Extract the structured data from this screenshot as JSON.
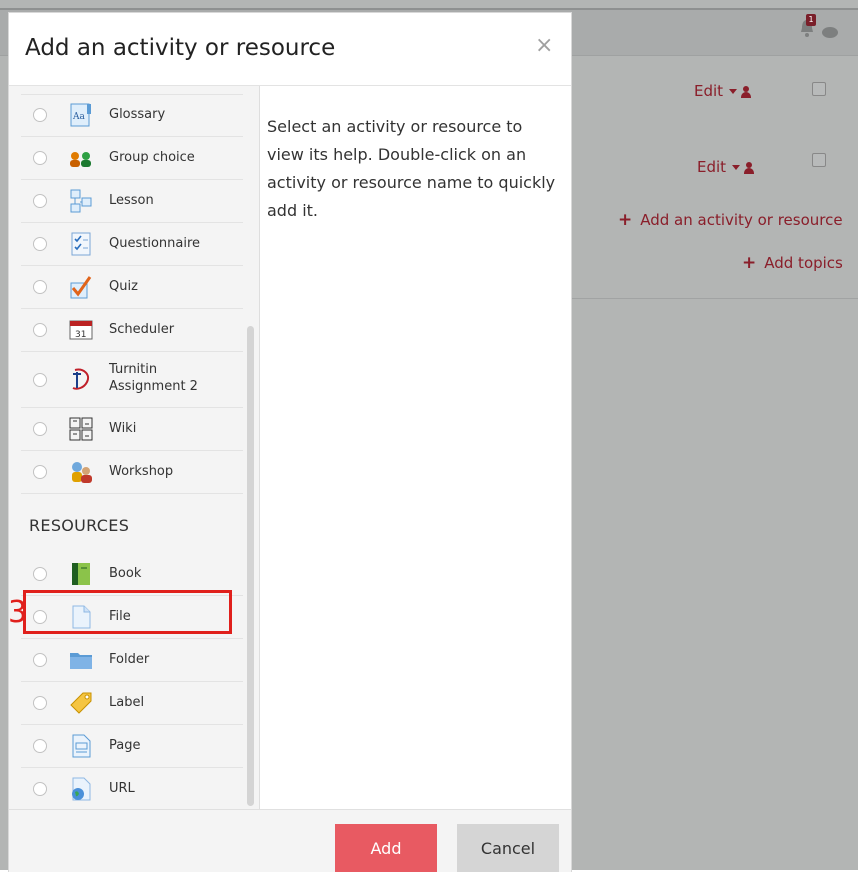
{
  "background": {
    "notification_count": "1",
    "rows": [
      {
        "edit_label": "Edit"
      },
      {
        "edit_label": "Edit"
      }
    ],
    "add_activity_label": "Add an activity or resource",
    "add_topics_label": "Add topics"
  },
  "modal": {
    "title": "Add an activity or resource",
    "close_glyph": "×",
    "activities": [
      {
        "label": "Glossary",
        "icon": "glossary-icon"
      },
      {
        "label": "Group choice",
        "icon": "group-choice-icon"
      },
      {
        "label": "Lesson",
        "icon": "lesson-icon"
      },
      {
        "label": "Questionnaire",
        "icon": "questionnaire-icon"
      },
      {
        "label": "Quiz",
        "icon": "quiz-icon"
      },
      {
        "label": "Scheduler",
        "icon": "scheduler-icon"
      },
      {
        "label": "Turnitin",
        "label2": "Assignment 2",
        "icon": "turnitin-icon"
      },
      {
        "label": "Wiki",
        "icon": "wiki-icon"
      },
      {
        "label": "Workshop",
        "icon": "workshop-icon"
      }
    ],
    "resources_header": "RESOURCES",
    "resources": [
      {
        "label": "Book",
        "icon": "book-icon"
      },
      {
        "label": "File",
        "icon": "file-icon"
      },
      {
        "label": "Folder",
        "icon": "folder-icon"
      },
      {
        "label": "Label",
        "icon": "label-tag-icon"
      },
      {
        "label": "Page",
        "icon": "page-icon"
      },
      {
        "label": "URL",
        "icon": "url-globe-icon"
      }
    ],
    "help_text": "Select an activity or resource to view its help. Double-click on an activity or resource name to quickly add it.",
    "add_button": "Add",
    "cancel_button": "Cancel",
    "calendar_day": "31"
  },
  "annotation": {
    "step_number": "3"
  }
}
